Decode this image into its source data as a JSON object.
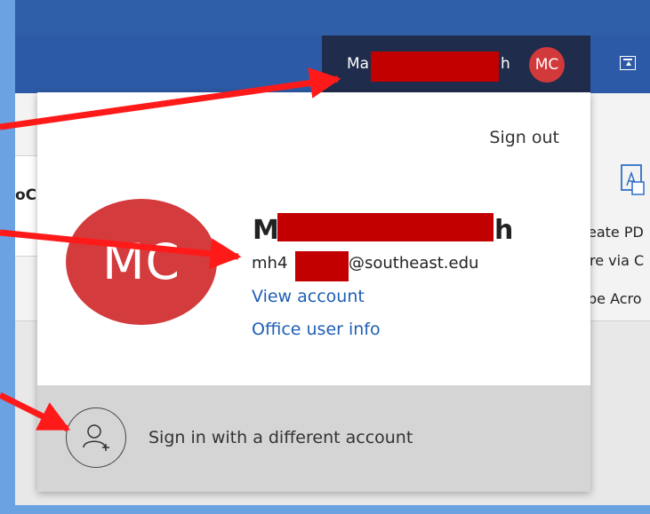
{
  "account_button": {
    "name_prefix": "Ma",
    "name_suffix": "h",
    "initials": "MC"
  },
  "panel": {
    "sign_out": "Sign out",
    "initials": "MC",
    "name_prefix": "M",
    "name_suffix": "h",
    "email_prefix": "mh4",
    "email_suffix": "@southeast.edu",
    "view_account": "View account",
    "office_user_info": "Office user info",
    "sign_in_different": "Sign in with a different account"
  },
  "ribbon_fragments": {
    "left": "oC",
    "right": [
      "eate PD",
      "re via C",
      "be Acro"
    ]
  },
  "colors": {
    "annotation": "#ff1a1a",
    "redaction": "#c30000",
    "avatar": "#d33b3d",
    "link": "#1f5fb5"
  },
  "icons": [
    "share-icon",
    "add-person-icon",
    "pdf-icon",
    "arrow-annotation"
  ]
}
